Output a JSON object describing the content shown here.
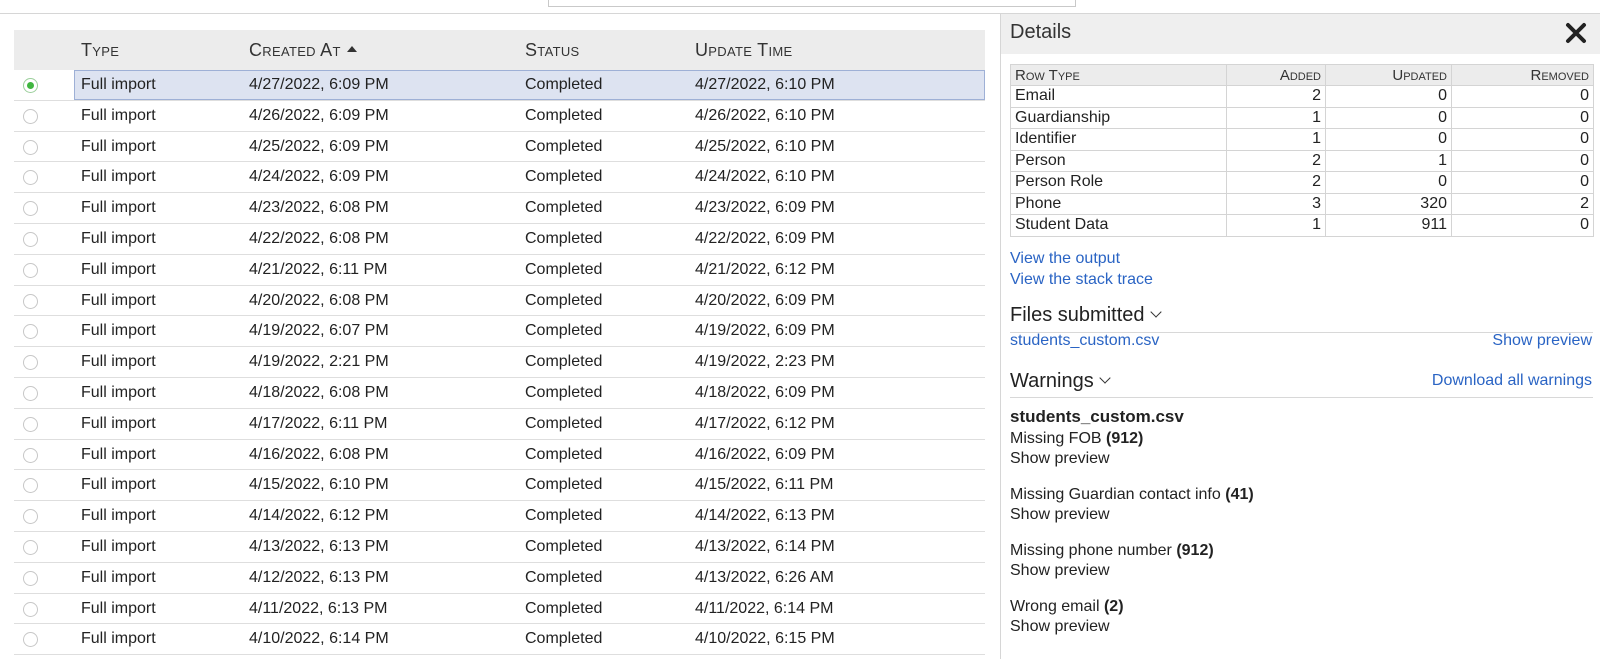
{
  "columns": {
    "type": "Type",
    "created_at": "Created At",
    "status": "Status",
    "update_time": "Update Time"
  },
  "rows": [
    {
      "type": "Full import",
      "created": "4/27/2022, 6:09 PM",
      "status": "Completed",
      "updated": "4/27/2022, 6:10 PM",
      "selected": true
    },
    {
      "type": "Full import",
      "created": "4/26/2022, 6:09 PM",
      "status": "Completed",
      "updated": "4/26/2022, 6:10 PM"
    },
    {
      "type": "Full import",
      "created": "4/25/2022, 6:09 PM",
      "status": "Completed",
      "updated": "4/25/2022, 6:10 PM"
    },
    {
      "type": "Full import",
      "created": "4/24/2022, 6:09 PM",
      "status": "Completed",
      "updated": "4/24/2022, 6:10 PM"
    },
    {
      "type": "Full import",
      "created": "4/23/2022, 6:08 PM",
      "status": "Completed",
      "updated": "4/23/2022, 6:09 PM"
    },
    {
      "type": "Full import",
      "created": "4/22/2022, 6:08 PM",
      "status": "Completed",
      "updated": "4/22/2022, 6:09 PM"
    },
    {
      "type": "Full import",
      "created": "4/21/2022, 6:11 PM",
      "status": "Completed",
      "updated": "4/21/2022, 6:12 PM"
    },
    {
      "type": "Full import",
      "created": "4/20/2022, 6:08 PM",
      "status": "Completed",
      "updated": "4/20/2022, 6:09 PM"
    },
    {
      "type": "Full import",
      "created": "4/19/2022, 6:07 PM",
      "status": "Completed",
      "updated": "4/19/2022, 6:09 PM"
    },
    {
      "type": "Full import",
      "created": "4/19/2022, 2:21 PM",
      "status": "Completed",
      "updated": "4/19/2022, 2:23 PM"
    },
    {
      "type": "Full import",
      "created": "4/18/2022, 6:08 PM",
      "status": "Completed",
      "updated": "4/18/2022, 6:09 PM"
    },
    {
      "type": "Full import",
      "created": "4/17/2022, 6:11 PM",
      "status": "Completed",
      "updated": "4/17/2022, 6:12 PM"
    },
    {
      "type": "Full import",
      "created": "4/16/2022, 6:08 PM",
      "status": "Completed",
      "updated": "4/16/2022, 6:09 PM"
    },
    {
      "type": "Full import",
      "created": "4/15/2022, 6:10 PM",
      "status": "Completed",
      "updated": "4/15/2022, 6:11 PM"
    },
    {
      "type": "Full import",
      "created": "4/14/2022, 6:12 PM",
      "status": "Completed",
      "updated": "4/14/2022, 6:13 PM"
    },
    {
      "type": "Full import",
      "created": "4/13/2022, 6:13 PM",
      "status": "Completed",
      "updated": "4/13/2022, 6:14 PM"
    },
    {
      "type": "Full import",
      "created": "4/12/2022, 6:13 PM",
      "status": "Completed",
      "updated": "4/13/2022, 6:26 AM"
    },
    {
      "type": "Full import",
      "created": "4/11/2022, 6:13 PM",
      "status": "Completed",
      "updated": "4/11/2022, 6:14 PM"
    },
    {
      "type": "Full import",
      "created": "4/10/2022, 6:14 PM",
      "status": "Completed",
      "updated": "4/10/2022, 6:15 PM"
    }
  ],
  "details": {
    "title": "Details",
    "close_icon": "close-x-icon",
    "table_headers": {
      "row_type": "Row Type",
      "added": "Added",
      "updated": "Updated",
      "removed": "Removed"
    },
    "table_rows": [
      {
        "row_type": "Email",
        "added": "2",
        "updated": "0",
        "removed": "0"
      },
      {
        "row_type": "Guardianship",
        "added": "1",
        "updated": "0",
        "removed": "0"
      },
      {
        "row_type": "Identifier",
        "added": "1",
        "updated": "0",
        "removed": "0"
      },
      {
        "row_type": "Person",
        "added": "2",
        "updated": "1",
        "removed": "0"
      },
      {
        "row_type": "Person Role",
        "added": "2",
        "updated": "0",
        "removed": "0"
      },
      {
        "row_type": "Phone",
        "added": "3",
        "updated": "320",
        "removed": "2"
      },
      {
        "row_type": "Student Data",
        "added": "1",
        "updated": "911",
        "removed": "0"
      }
    ],
    "view_output": "View the output",
    "view_stack_trace": "View the stack trace",
    "files_submitted_title": "Files submitted",
    "file_name": "students_custom.csv",
    "show_preview": "Show preview",
    "warnings_title": "Warnings",
    "download_all_warnings": "Download all warnings",
    "warnings_file": "students_custom.csv",
    "warnings": [
      {
        "label": "Missing FOB",
        "count": "(912)",
        "link": "Show preview"
      },
      {
        "label": "Missing Guardian contact info",
        "count": "(41)",
        "link": "Show preview"
      },
      {
        "label": "Missing phone number",
        "count": "(912)",
        "link": "Show preview"
      },
      {
        "label": "Wrong email",
        "count": "(2)",
        "link": "Show preview"
      }
    ]
  },
  "colors": {
    "link": "#2a64c4",
    "selected_row_bg": "#dde3f1",
    "radio_on": "#3fb63f",
    "header_bg": "#ececec"
  }
}
